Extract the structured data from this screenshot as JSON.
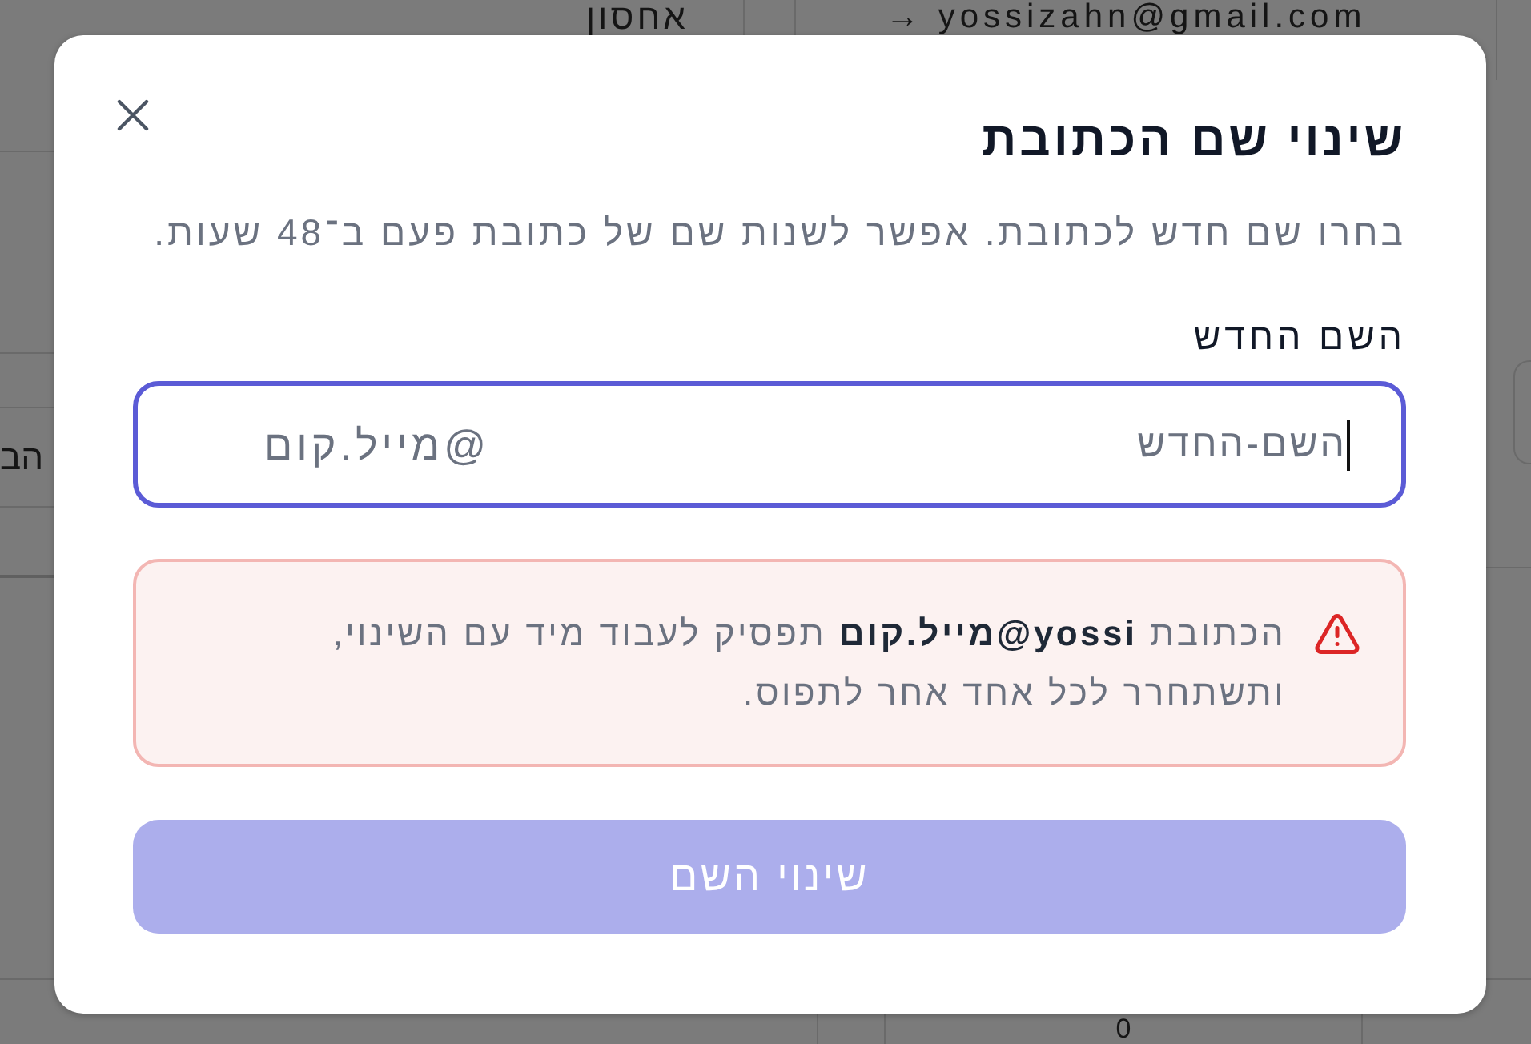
{
  "background_page": {
    "column_label": "אחסון",
    "email": "→ yossizahn@gmail.com",
    "side_text": "הב",
    "cell_value": "0"
  },
  "dialog": {
    "title": "שינוי שם הכתובת",
    "description": "בחרו שם חדש לכתובת. אפשר לשנות שם של כתובת פעם ב־48 שעות.",
    "field": {
      "label": "השם החדש",
      "placeholder": "השם-החדש",
      "suffix": "@מייל.קום",
      "focused": true
    },
    "warning": {
      "text": "הכתובת **yossi@מייל.קום** תפסיק לעבוד מיד עם השינוי, ותשתחרר לכל אחד אחר לתפוס."
    },
    "submit_button": {
      "label": "שינוי השם",
      "disabled": true
    }
  }
}
